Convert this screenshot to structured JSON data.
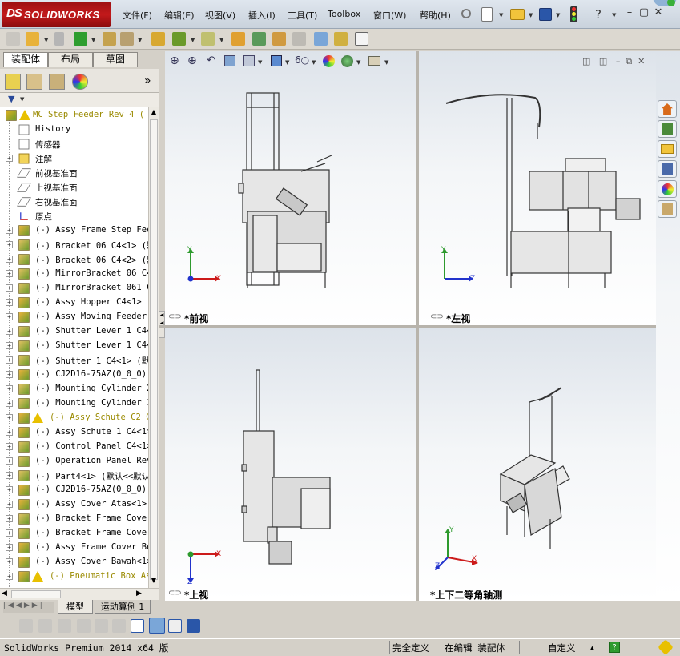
{
  "app": {
    "logo_ds": "DS",
    "logo_text": "SOLIDWORKS"
  },
  "menu": [
    "文件(F)",
    "编辑(E)",
    "视图(V)",
    "插入(I)",
    "工具(T)",
    "Toolbox",
    "窗口(W)",
    "帮助(H)"
  ],
  "help_label": "?",
  "left_tabs": [
    "装配体",
    "布局",
    "草图"
  ],
  "feature_manager_more": "»",
  "tree": [
    {
      "label": "MC Step Feeder Rev 4  (",
      "kind": "root",
      "warn": true
    },
    {
      "label": "History",
      "kind": "folder"
    },
    {
      "label": "传感器",
      "kind": "folder"
    },
    {
      "label": "注解",
      "kind": "annotation",
      "expand": "+"
    },
    {
      "label": "前视基准面",
      "kind": "plane"
    },
    {
      "label": "上视基准面",
      "kind": "plane"
    },
    {
      "label": "右视基准面",
      "kind": "plane"
    },
    {
      "label": "原点",
      "kind": "origin"
    },
    {
      "label": "(-) Assy Frame Step Fee",
      "kind": "asm",
      "expand": "+"
    },
    {
      "label": "(-) Bracket 06 C4<1> (默",
      "kind": "part",
      "expand": "+"
    },
    {
      "label": "(-) Bracket 06 C4<2> (默",
      "kind": "part",
      "expand": "+"
    },
    {
      "label": "(-) MirrorBracket 06 C4",
      "kind": "part",
      "expand": "+"
    },
    {
      "label": "(-) MirrorBracket 061 C",
      "kind": "part",
      "expand": "+"
    },
    {
      "label": "(-) Assy Hopper C4<1> (",
      "kind": "asm",
      "expand": "+"
    },
    {
      "label": "(-) Assy Moving Feeder",
      "kind": "asm",
      "expand": "+"
    },
    {
      "label": "(-) Shutter Lever 1 C4<",
      "kind": "part",
      "expand": "+"
    },
    {
      "label": "(-) Shutter Lever 1 C4<",
      "kind": "part",
      "expand": "+"
    },
    {
      "label": "(-) Shutter 1 C4<1> (默",
      "kind": "part",
      "expand": "+"
    },
    {
      "label": "(-) CJ2D16-75AZ(0_0_0)(",
      "kind": "asm",
      "expand": "+"
    },
    {
      "label": "(-) Mounting Cylinder 2",
      "kind": "part",
      "expand": "+"
    },
    {
      "label": "(-) Mounting Cylinder 1",
      "kind": "part",
      "expand": "+"
    },
    {
      "label": "(-) Assy Schute C2 C",
      "kind": "asm",
      "expand": "+",
      "warn": true
    },
    {
      "label": "(-) Assy Schute 1 C4<1>",
      "kind": "asm",
      "expand": "+"
    },
    {
      "label": "(-) Control Panel C4<1>",
      "kind": "part",
      "expand": "+"
    },
    {
      "label": "(-) Operation Panel Rev",
      "kind": "part",
      "expand": "+"
    },
    {
      "label": "(-) Part4<1> (默认<<默认",
      "kind": "part",
      "expand": "+"
    },
    {
      "label": "(-) CJ2D16-75AZ(0_0_0)(",
      "kind": "asm",
      "expand": "+"
    },
    {
      "label": "(-) Assy Cover Atas<1>",
      "kind": "asm",
      "expand": "+"
    },
    {
      "label": "(-) Bracket Frame Cover",
      "kind": "part",
      "expand": "+"
    },
    {
      "label": "(-) Bracket Frame Cover",
      "kind": "part",
      "expand": "+"
    },
    {
      "label": "(-) Assy Frame Cover Be",
      "kind": "asm",
      "expand": "+"
    },
    {
      "label": "(-) Assy Cover Bawah<1>",
      "kind": "asm",
      "expand": "+"
    },
    {
      "label": "(-) Pneumatic Box As",
      "kind": "asm",
      "expand": "+",
      "warn": true
    }
  ],
  "bottom_tabs": [
    "模型",
    "运动算例 1"
  ],
  "viewports": [
    {
      "label": "*前视",
      "axis_h": "X",
      "axis_v": "Y"
    },
    {
      "label": "*左视",
      "axis_h": "Z",
      "axis_v": "Y"
    },
    {
      "label": "*上视",
      "axis_h": "X",
      "axis_v": "Z"
    },
    {
      "label": "*上下二等角轴测",
      "axis_x": "X",
      "axis_y": "Y",
      "axis_z": "Z"
    }
  ],
  "status": {
    "product": "SolidWorks Premium 2014 x64 版",
    "definition": "完全定义",
    "mode": "在编辑 装配体",
    "units": "自定义",
    "up_arrow": "▲",
    "help": "?"
  },
  "colors": {
    "logo_red": "#c3191b",
    "axis_red": "#cc1a1a",
    "axis_green": "#2e9a2e",
    "axis_blue": "#2233cc",
    "warn_yellow": "#e8c000"
  }
}
